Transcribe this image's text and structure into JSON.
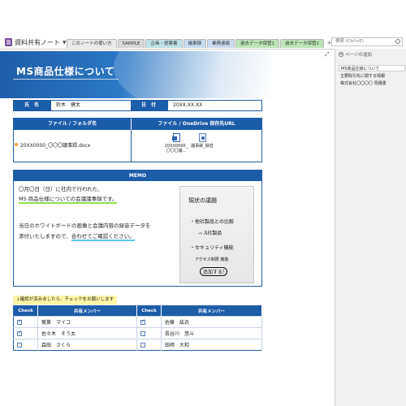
{
  "notebook": {
    "title": "資料共有ノート",
    "arrow": "▼"
  },
  "tabs": [
    {
      "label": "このノートの使い方",
      "color": "#e9e9e9"
    },
    {
      "label": "SAMPLE",
      "color": "#d7d7d7"
    },
    {
      "label": "企画・提案書",
      "color": "#bfe1e6"
    },
    {
      "label": "議事録",
      "color": "#c6dcef"
    },
    {
      "label": "業務連絡",
      "color": "#cbdcf0"
    },
    {
      "label": "過去データ保管1",
      "color": "#bde4b8"
    },
    {
      "label": "過去データ保管2",
      "color": "#bde4b8"
    }
  ],
  "tab_plus": "+",
  "search": {
    "placeholder": "検索 (Ctrl+E)"
  },
  "page_title": "MS商品仕様について",
  "info": {
    "name_label": "氏 名",
    "name_value": "鈴木　健太",
    "date_label": "日 付",
    "date_value": "20XX.XX.XX"
  },
  "files": {
    "col1": "ファイル / フォルダ名",
    "col2": "ファイル / OneDrive 保存先URL",
    "filename": "20XX0000_〇〇〇議事録.docx",
    "doc1": "20XX0000_〇〇〇議...",
    "doc2": "議事録_録音"
  },
  "memo": {
    "title": "MEMO",
    "line1": "〇月〇日（日）に社内で行われた、",
    "line2": "MS 商品仕様についての会議議事録です。",
    "line3": "当日のホワイトボードの画像と会議内容の録音データを",
    "line4a": "添付いたしますので、",
    "line4b": "合わせてご確認ください。",
    "whiteboard": {
      "l1": "現状の議題",
      "l2": "・他社製品との比較",
      "l3": "→ A社製品",
      "l4": "・セキュリティ機能",
      "l5": "アクセス制限 機能",
      "l6": "追加する!"
    }
  },
  "notice": "↓確認が済みましたら、チェックをお願いします",
  "checklist": {
    "h_check": "Check",
    "h_member": "共有メンバー",
    "rows": [
      {
        "c1": true,
        "m1": "鷲巣　マイコ",
        "c2": true,
        "m2": "佐藤　紘衣"
      },
      {
        "c1": true,
        "m1": "佐々木　そう太",
        "c2": false,
        "m2": "長谷川　悠斗"
      },
      {
        "c1": false,
        "m1": "森田　さくら",
        "c2": false,
        "m2": "田﨑　大和"
      }
    ]
  },
  "pane": {
    "add_page": "ページの追加",
    "pages": [
      "MS商品仕様について",
      "主要取引先に関する情報",
      "株式会社〇〇〇〇 見積書"
    ]
  },
  "colors": {
    "accent": "#1c5da8",
    "highlight_green": "#8ee04a",
    "highlight_blue": "#5ec7e6",
    "notice": "#fdf6a6"
  }
}
